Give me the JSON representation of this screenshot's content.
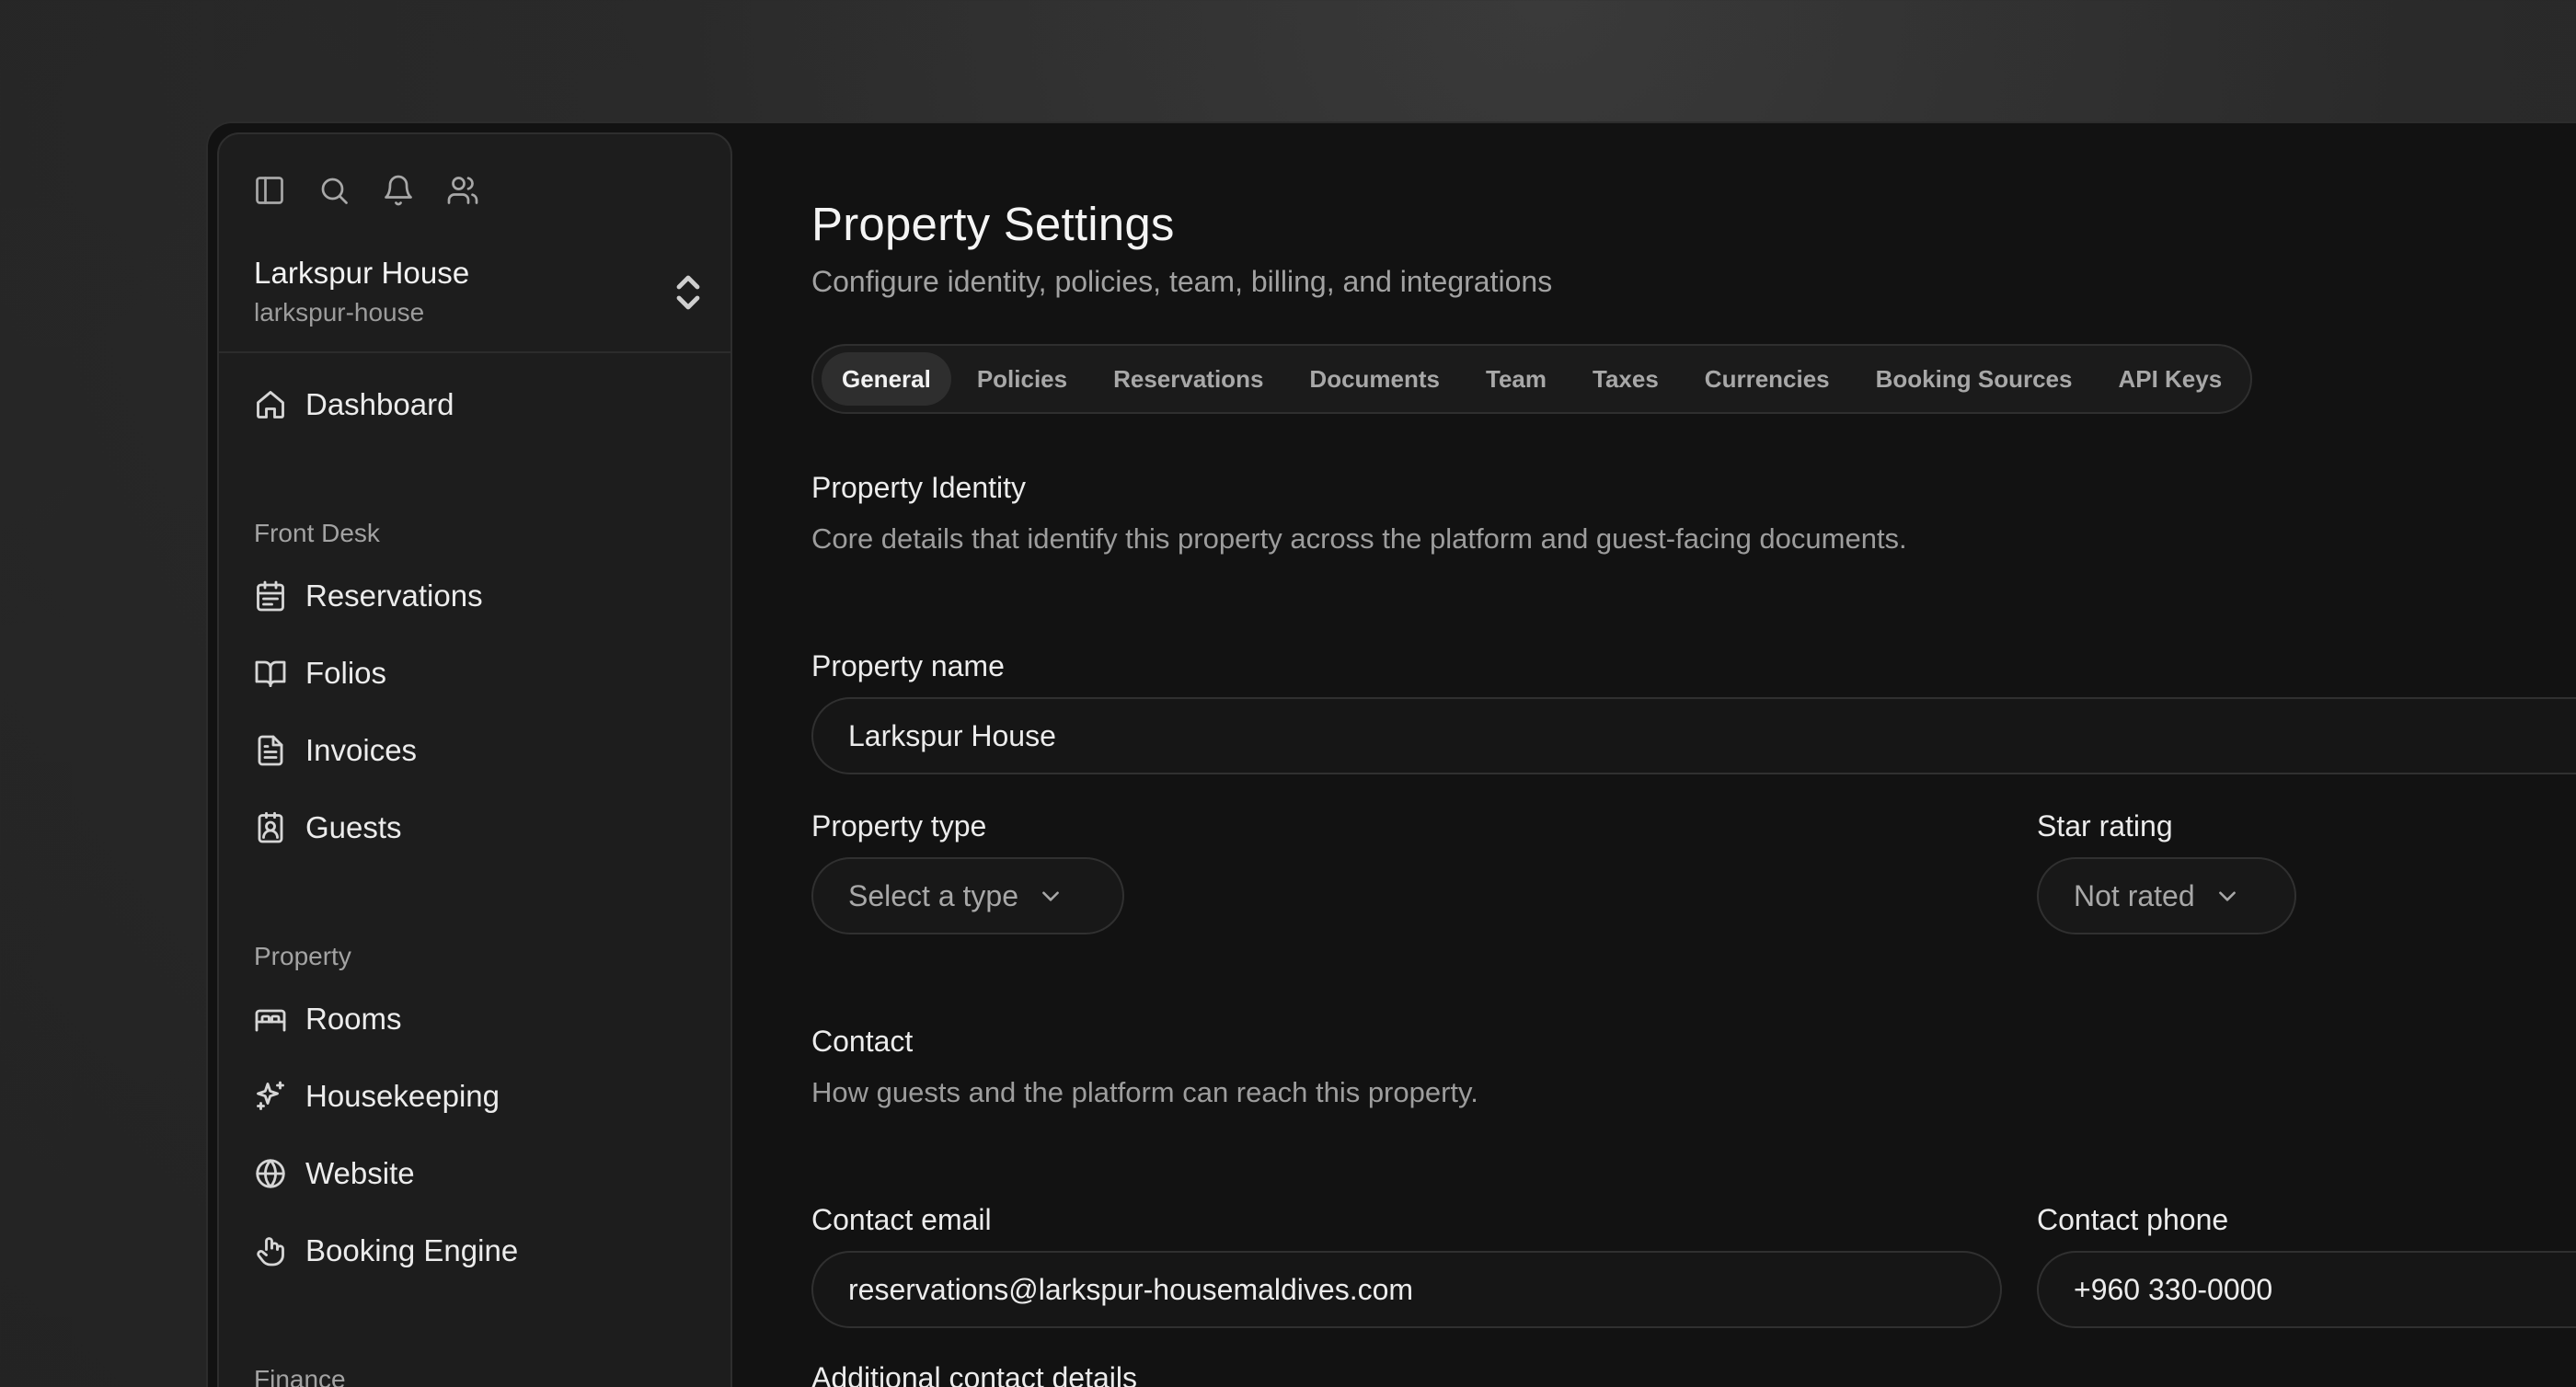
{
  "sidebar": {
    "top_icons": [
      "sidebar-toggle-icon",
      "search-icon",
      "bell-icon",
      "users-icon"
    ],
    "property": {
      "name": "Larkspur House",
      "slug": "larkspur-house"
    },
    "dashboard": "Dashboard",
    "sections": [
      {
        "title": "Front Desk",
        "items": [
          "Reservations",
          "Folios",
          "Invoices",
          "Guests"
        ]
      },
      {
        "title": "Property",
        "items": [
          "Rooms",
          "Housekeeping",
          "Website",
          "Booking Engine"
        ]
      },
      {
        "title": "Finance",
        "items": []
      }
    ]
  },
  "page": {
    "title": "Property Settings",
    "subtitle": "Configure identity, policies, team, billing, and integrations"
  },
  "tabs": [
    {
      "label": "General",
      "active": true
    },
    {
      "label": "Policies"
    },
    {
      "label": "Reservations"
    },
    {
      "label": "Documents"
    },
    {
      "label": "Team"
    },
    {
      "label": "Taxes"
    },
    {
      "label": "Currencies"
    },
    {
      "label": "Booking Sources"
    },
    {
      "label": "API Keys"
    }
  ],
  "identity": {
    "title": "Property Identity",
    "description": "Core details that identify this property across the platform and guest-facing documents.",
    "property_name_label": "Property name",
    "property_name_value": "Larkspur House",
    "property_type_label": "Property type",
    "property_type_value": "Select a type",
    "star_rating_label": "Star rating",
    "star_rating_value": "Not rated"
  },
  "contact": {
    "title": "Contact",
    "description": "How guests and the platform can reach this property.",
    "email_label": "Contact email",
    "email_value": "reservations@larkspur-housemaldives.com",
    "phone_label": "Contact phone",
    "phone_value": "+960 330-0000",
    "additional_label": "Additional contact details"
  },
  "colors": {
    "background": "#121212",
    "sidebar": "#1d1d1d",
    "text": "#ececec",
    "muted": "#9d9d9d",
    "active_tab": "#2e2e2e"
  }
}
